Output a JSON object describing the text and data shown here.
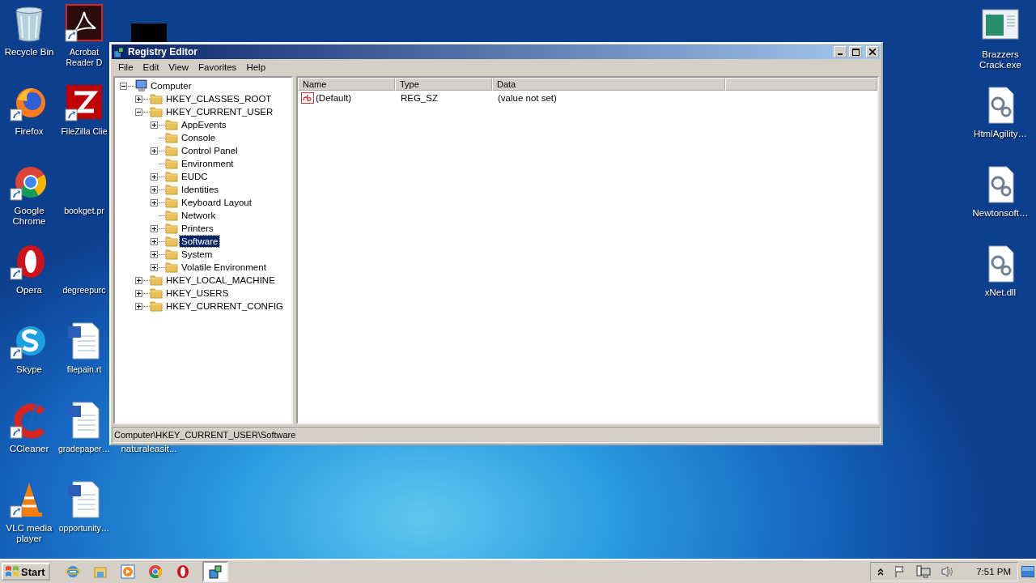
{
  "desktop": {
    "columns": [
      [
        {
          "label": "Recycle Bin",
          "kind": "recycle-bin",
          "shortcut": false
        },
        {
          "label": "Firefox",
          "kind": "firefox",
          "shortcut": true
        },
        {
          "label": "Google Chrome",
          "kind": "chrome",
          "shortcut": true
        },
        {
          "label": "Opera",
          "kind": "opera",
          "shortcut": true
        },
        {
          "label": "Skype",
          "kind": "skype",
          "shortcut": true
        },
        {
          "label": "CCleaner",
          "kind": "ccleaner",
          "shortcut": true
        },
        {
          "label": "VLC media player",
          "kind": "vlc",
          "shortcut": true
        }
      ],
      [
        {
          "label": "Acrobat Reader D",
          "kind": "pdf",
          "shortcut": true
        },
        {
          "label": "FileZilla Clie",
          "kind": "filezilla",
          "shortcut": true
        },
        {
          "label": "bookget.pr",
          "kind": "none"
        },
        {
          "label": "degreepurc",
          "kind": "none"
        },
        {
          "label": "filepain.rt",
          "kind": "word",
          "shortcut": false
        },
        {
          "label": "gradepaper…",
          "kind": "word",
          "shortcut": false
        },
        {
          "label": "opportunity…",
          "kind": "word",
          "shortcut": false
        }
      ],
      [
        {
          "kind": "dark-image",
          "shortcut": false
        },
        null,
        null,
        null,
        null,
        {
          "label": "naturaleasit...",
          "kind": "none"
        },
        null
      ]
    ],
    "right_icons": [
      {
        "label": "Brazzers Crack.exe",
        "kind": "exe",
        "shortcut": false
      },
      {
        "label": "HtmlAgility…",
        "kind": "dll",
        "shortcut": false
      },
      {
        "label": "Newtonsoft…",
        "kind": "dll",
        "shortcut": false
      },
      {
        "label": "xNet.dll",
        "kind": "dll",
        "shortcut": false
      }
    ]
  },
  "window": {
    "title": "Registry Editor",
    "menu": [
      "File",
      "Edit",
      "View",
      "Favorites",
      "Help"
    ],
    "tree": [
      {
        "label": "Computer",
        "kind": "computer",
        "expandable": true,
        "expanded": true,
        "selected": false,
        "children": [
          {
            "label": "HKEY_CLASSES_ROOT",
            "kind": "folder",
            "expandable": true,
            "expanded": false,
            "selected": false
          },
          {
            "label": "HKEY_CURRENT_USER",
            "kind": "folder",
            "expandable": true,
            "expanded": true,
            "selected": false,
            "children": [
              {
                "label": "AppEvents",
                "kind": "folder",
                "expandable": true,
                "expanded": false,
                "selected": false
              },
              {
                "label": "Console",
                "kind": "folder",
                "expandable": false,
                "selected": false
              },
              {
                "label": "Control Panel",
                "kind": "folder",
                "expandable": true,
                "expanded": false,
                "selected": false
              },
              {
                "label": "Environment",
                "kind": "folder",
                "expandable": false,
                "selected": false
              },
              {
                "label": "EUDC",
                "kind": "folder",
                "expandable": true,
                "expanded": false,
                "selected": false
              },
              {
                "label": "Identities",
                "kind": "folder",
                "expandable": true,
                "expanded": false,
                "selected": false
              },
              {
                "label": "Keyboard Layout",
                "kind": "folder",
                "expandable": true,
                "expanded": false,
                "selected": false
              },
              {
                "label": "Network",
                "kind": "folder",
                "expandable": false,
                "selected": false
              },
              {
                "label": "Printers",
                "kind": "folder",
                "expandable": true,
                "expanded": false,
                "selected": false
              },
              {
                "label": "Software",
                "kind": "folder",
                "expandable": true,
                "expanded": false,
                "selected": true
              },
              {
                "label": "System",
                "kind": "folder",
                "expandable": true,
                "expanded": false,
                "selected": false
              },
              {
                "label": "Volatile Environment",
                "kind": "folder",
                "expandable": true,
                "expanded": false,
                "selected": false
              }
            ]
          },
          {
            "label": "HKEY_LOCAL_MACHINE",
            "kind": "folder",
            "expandable": true,
            "expanded": false,
            "selected": false
          },
          {
            "label": "HKEY_USERS",
            "kind": "folder",
            "expandable": true,
            "expanded": false,
            "selected": false
          },
          {
            "label": "HKEY_CURRENT_CONFIG",
            "kind": "folder",
            "expandable": true,
            "expanded": false,
            "selected": false
          }
        ]
      }
    ],
    "list": {
      "columns": [
        "Name",
        "Type",
        "Data"
      ],
      "rows": [
        {
          "name": "(Default)",
          "type": "REG_SZ",
          "data": "(value not set)",
          "kind": "string"
        }
      ]
    },
    "status_bar": "Computer\\HKEY_CURRENT_USER\\Software"
  },
  "taskbar": {
    "start": "Start",
    "apps": [
      {
        "kind": "ie",
        "active": false
      },
      {
        "kind": "explorer",
        "active": false
      },
      {
        "kind": "media",
        "active": false
      },
      {
        "kind": "chrome",
        "active": false
      },
      {
        "kind": "opera",
        "active": false
      },
      {
        "kind": "regedit",
        "active": true
      }
    ],
    "clock": "7:51 PM"
  }
}
